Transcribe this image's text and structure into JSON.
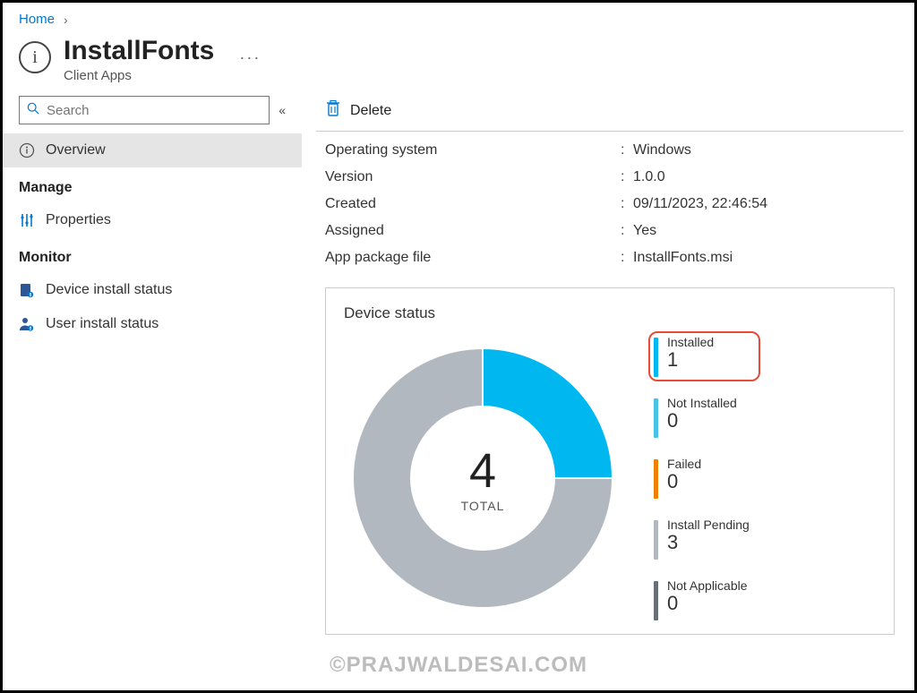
{
  "breadcrumb": {
    "home": "Home"
  },
  "header": {
    "title": "InstallFonts",
    "subtitle": "Client Apps"
  },
  "search": {
    "placeholder": "Search"
  },
  "sidebar": {
    "overview": "Overview",
    "manage_section": "Manage",
    "properties": "Properties",
    "monitor_section": "Monitor",
    "device_install": "Device install status",
    "user_install": "User install status"
  },
  "cmdbar": {
    "delete": "Delete"
  },
  "details": {
    "os_label": "Operating system",
    "os_value": "Windows",
    "version_label": "Version",
    "version_value": "1.0.0",
    "created_label": "Created",
    "created_value": "09/11/2023, 22:46:54",
    "assigned_label": "Assigned",
    "assigned_value": "Yes",
    "pkg_label": "App package file",
    "pkg_value": "InstallFonts.msi"
  },
  "card": {
    "title": "Device status",
    "total_label": "TOTAL",
    "legend": {
      "installed": "Installed",
      "not_installed": "Not Installed",
      "failed": "Failed",
      "pending": "Install Pending",
      "na": "Not Applicable"
    }
  },
  "chart_data": {
    "type": "pie",
    "title": "Device status",
    "total": 4,
    "series": [
      {
        "name": "Installed",
        "value": 1,
        "color": "#00b7ef"
      },
      {
        "name": "Not Installed",
        "value": 0,
        "color": "#49c2e8"
      },
      {
        "name": "Failed",
        "value": 0,
        "color": "#f08000"
      },
      {
        "name": "Install Pending",
        "value": 3,
        "color": "#b1b8bf"
      },
      {
        "name": "Not Applicable",
        "value": 0,
        "color": "#6a6f77"
      }
    ]
  },
  "watermark": "©PRAJWALDESAI.COM"
}
